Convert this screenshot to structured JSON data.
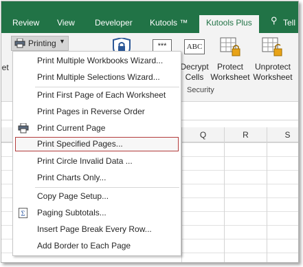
{
  "ribbon_tabs": {
    "review": "Review",
    "view": "View",
    "developer": "Developer",
    "kutools": "Kutools ™",
    "kutools_plus": "Kutools Plus",
    "tell": "Tell"
  },
  "ribbon": {
    "left_cut": "eet",
    "printing": "Printing",
    "decrypt_line1": "Decrypt",
    "decrypt_line2": "Cells",
    "protect_line1": "Protect",
    "protect_line2": "Worksheet",
    "unprotect_line1": "Unprotect",
    "unprotect_line2": "Worksheet",
    "group_label": "Security"
  },
  "columns": [
    "Q",
    "R",
    "S"
  ],
  "menu_items": [
    {
      "label": "Print Multiple Workbooks Wizard...",
      "icon": null
    },
    {
      "label": "Print Multiple Selections Wizard...",
      "icon": null
    },
    {
      "label": "Print First Page of Each Worksheet",
      "icon": null
    },
    {
      "label": "Print Pages in Reverse Order",
      "icon": null
    },
    {
      "label": "Print Current Page",
      "icon": "printer-icon"
    },
    {
      "label": "Print Specified Pages...",
      "icon": null,
      "highlighted": true
    },
    {
      "label": "Print Circle Invalid Data ...",
      "icon": null
    },
    {
      "label": "Print Charts Only...",
      "icon": null
    },
    {
      "label": "Copy Page Setup...",
      "icon": null
    },
    {
      "label": "Paging Subtotals...",
      "icon": "sigma-icon"
    },
    {
      "label": "Insert Page Break Every Row...",
      "icon": null
    },
    {
      "label": "Add Border to Each Page",
      "icon": null
    }
  ],
  "colors": {
    "tab_bar": "#217346",
    "highlight_border": "#b33a3a"
  }
}
